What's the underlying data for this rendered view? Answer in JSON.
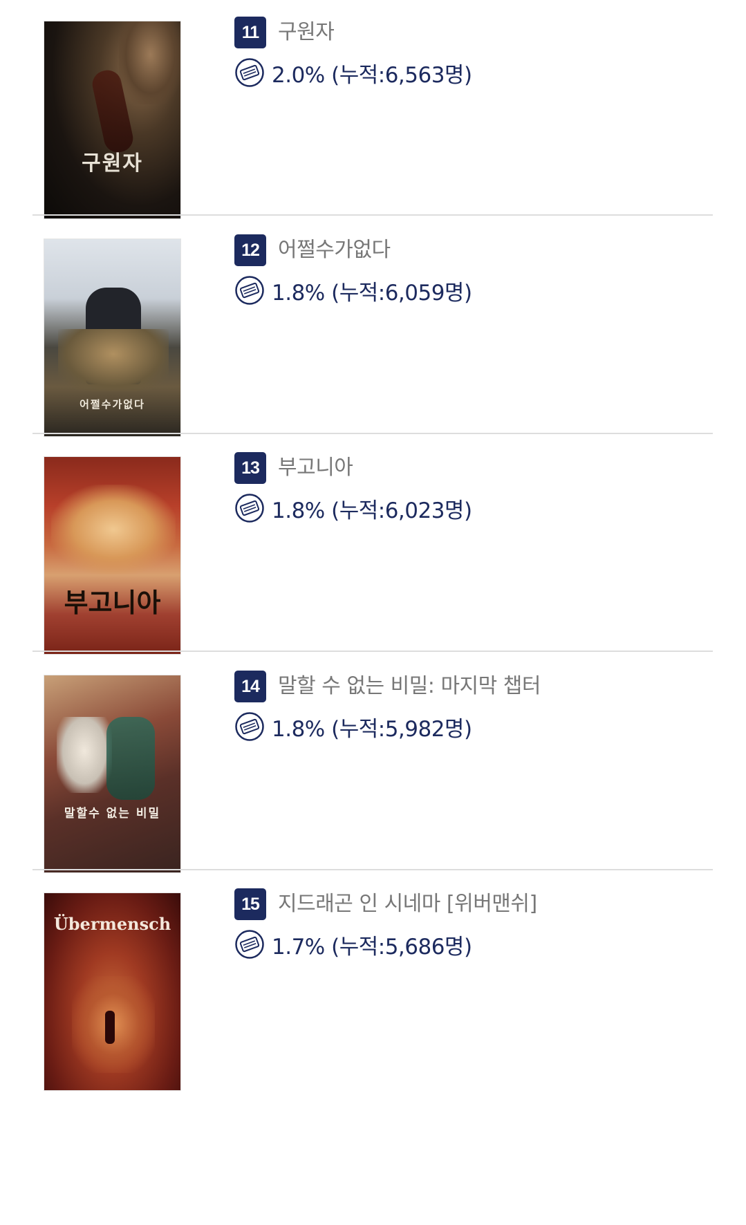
{
  "colors": {
    "rank_badge": "#1c2a5e",
    "stat_text": "#1c2a5e",
    "title_text": "#777777",
    "divider": "#dddddd"
  },
  "icons": {
    "ticket": "ticket-icon"
  },
  "items": [
    {
      "rank": "11",
      "title": "구원자",
      "stat": "2.0% (누적:6,563명)",
      "poster_text": "구원자"
    },
    {
      "rank": "12",
      "title": "어쩔수가없다",
      "stat": "1.8% (누적:6,059명)",
      "poster_text": "어쩔수가없다"
    },
    {
      "rank": "13",
      "title": "부고니아",
      "stat": "1.8% (누적:6,023명)",
      "poster_text": "부고니아"
    },
    {
      "rank": "14",
      "title": "말할 수 없는 비밀: 마지막 챕터",
      "stat": "1.8% (누적:5,982명)",
      "poster_text": "말할수 없는 비밀"
    },
    {
      "rank": "15",
      "title": "지드래곤 인 시네마 [위버맨쉬]",
      "stat": "1.7% (누적:5,686명)",
      "poster_text": "Übermensch"
    }
  ]
}
